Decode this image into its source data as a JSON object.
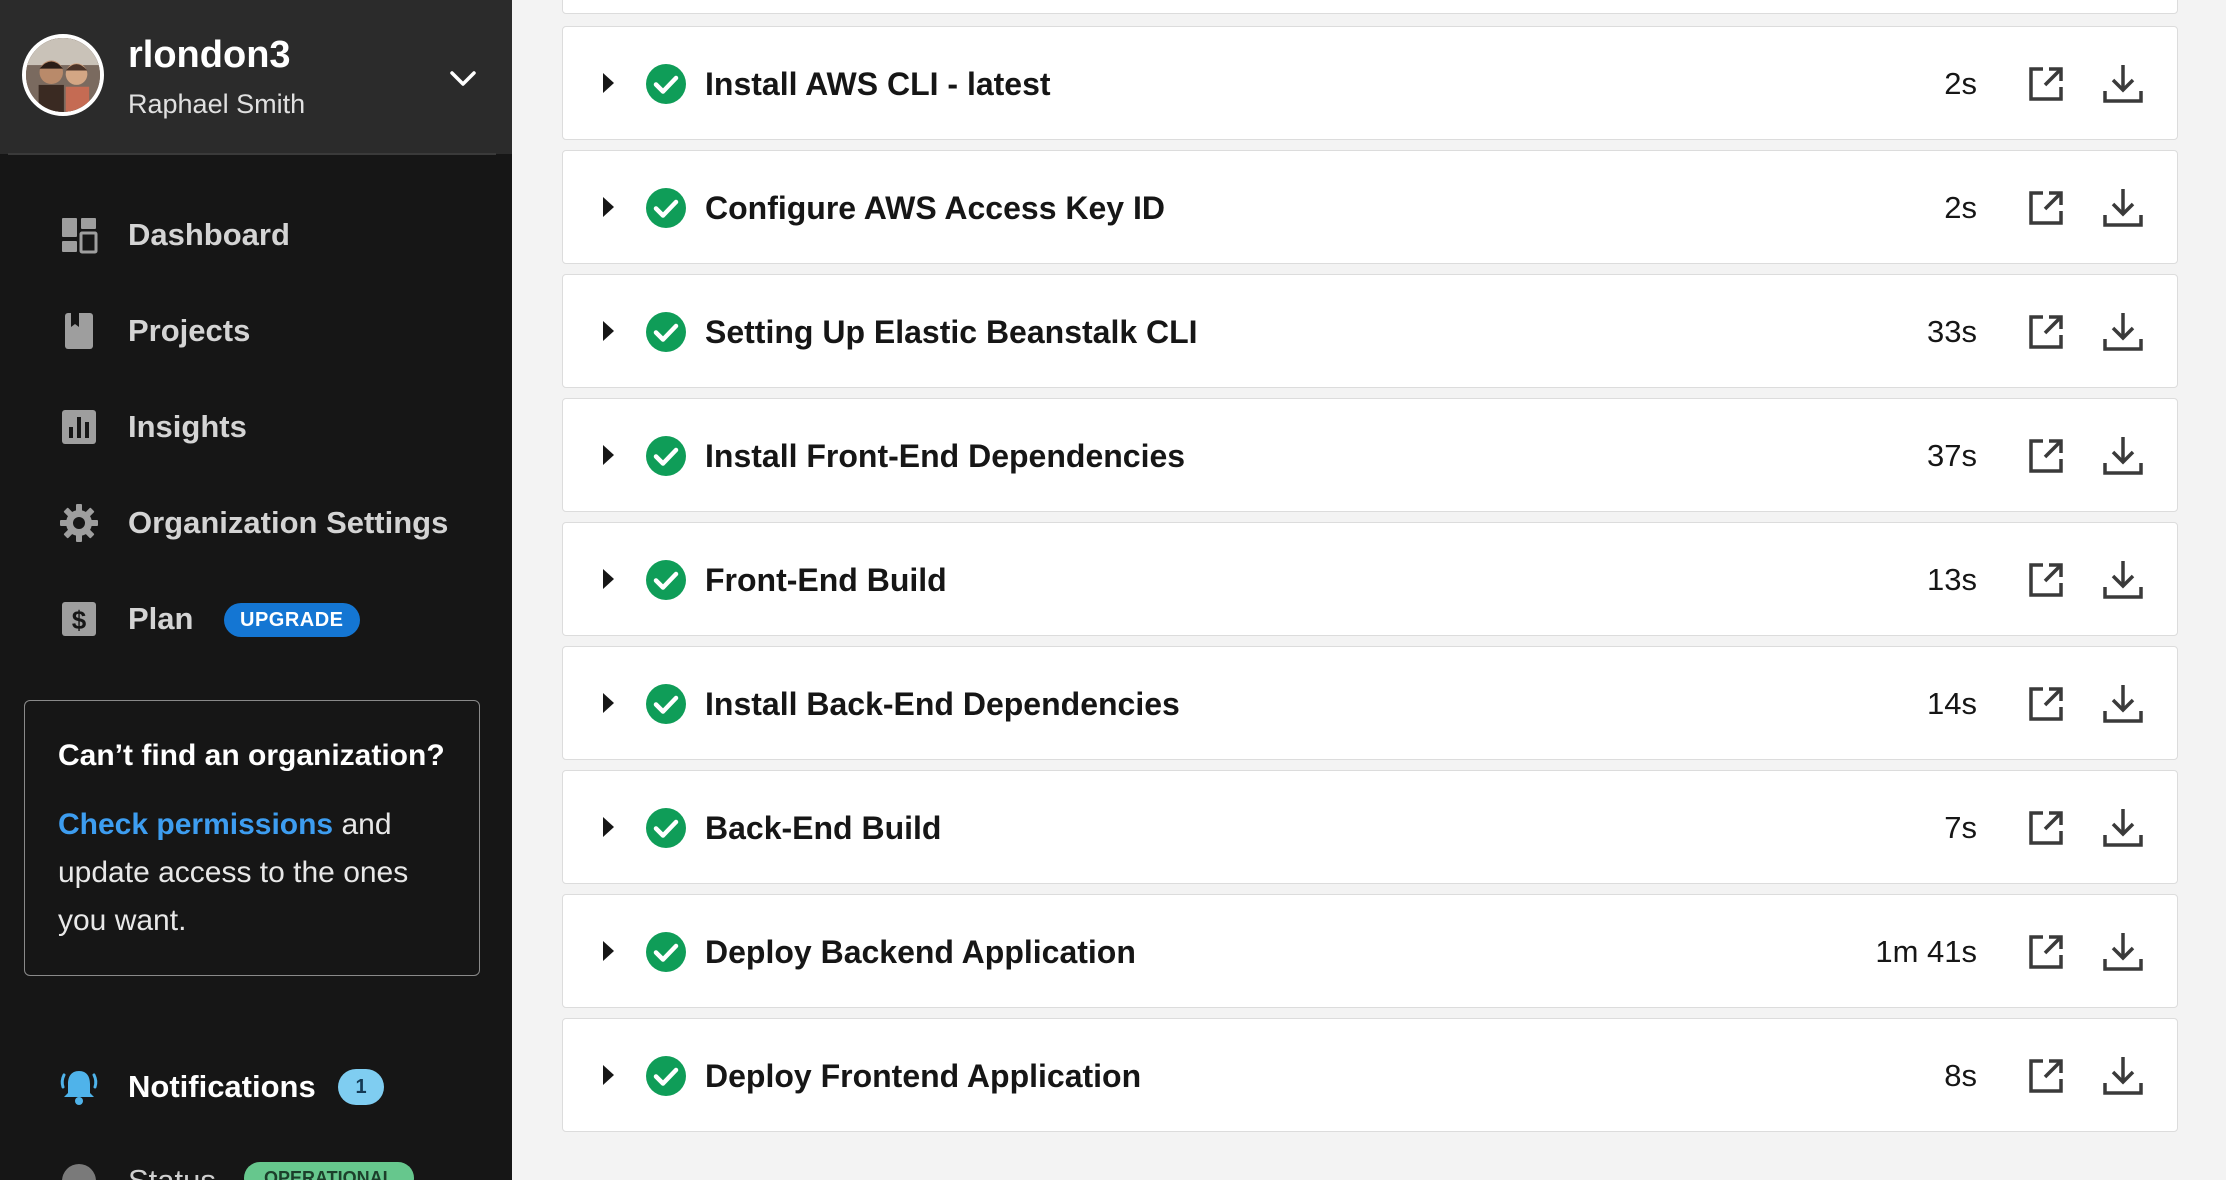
{
  "user": {
    "username": "rlondon3",
    "full_name": "Raphael Smith"
  },
  "sidebar": {
    "items": [
      {
        "label": "Dashboard",
        "icon": "dashboard-icon"
      },
      {
        "label": "Projects",
        "icon": "book-icon"
      },
      {
        "label": "Insights",
        "icon": "bar-chart-icon"
      },
      {
        "label": "Organization Settings",
        "icon": "gear-icon"
      },
      {
        "label": "Plan",
        "icon": "dollar-icon",
        "badge": "UPGRADE"
      }
    ],
    "org_prompt": {
      "title": "Can’t find an organization?",
      "link": "Check permissions",
      "text_after_link": " and update access to the ones you want."
    },
    "notifications": {
      "label": "Notifications",
      "count": "1",
      "icon": "bell-icon"
    },
    "status": {
      "label": "Status",
      "badge": "OPERATIONAL",
      "icon": "status-icon"
    }
  },
  "steps": [
    {
      "name": "Install AWS CLI - latest",
      "duration": "2s"
    },
    {
      "name": "Configure AWS Access Key ID",
      "duration": "2s"
    },
    {
      "name": "Setting Up Elastic Beanstalk CLI",
      "duration": "33s"
    },
    {
      "name": "Install Front-End Dependencies",
      "duration": "37s"
    },
    {
      "name": "Front-End Build",
      "duration": "13s"
    },
    {
      "name": "Install Back-End Dependencies",
      "duration": "14s"
    },
    {
      "name": "Back-End Build",
      "duration": "7s"
    },
    {
      "name": "Deploy Backend Application",
      "duration": "1m 41s"
    },
    {
      "name": "Deploy Frontend Application",
      "duration": "8s"
    }
  ],
  "colors": {
    "sidebar_bg": "#161616",
    "header_bg": "#2b2b2b",
    "accent_blue": "#1476d3",
    "link_blue": "#3d9df0",
    "success_green": "#0f9d58",
    "notif_badge": "#7fcdf1",
    "status_green": "#66c78d"
  }
}
